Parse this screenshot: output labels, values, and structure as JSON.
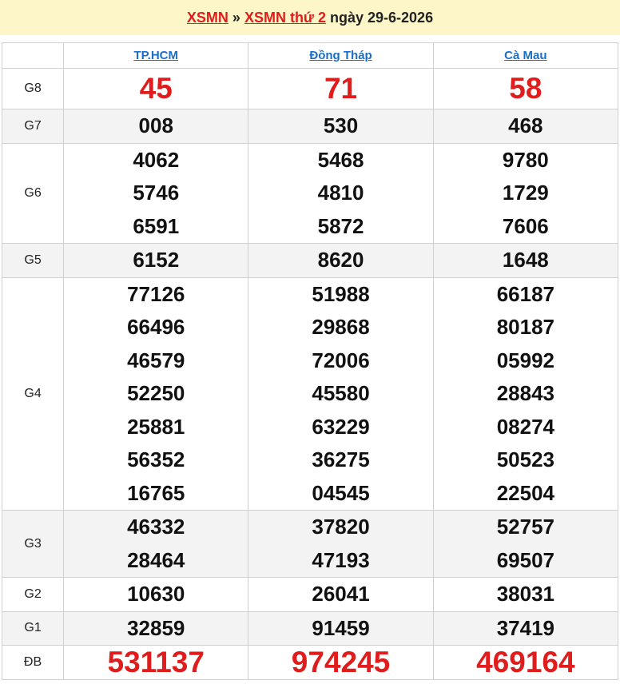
{
  "header": {
    "link1": "XSMN",
    "sep": "»",
    "link2": "XSMN thứ 2",
    "date_text": "ngày 29-6-2026"
  },
  "provinces": [
    "TP.HCM",
    "Đồng Tháp",
    "Cà Mau"
  ],
  "prizes": [
    {
      "label": "G8",
      "results": [
        [
          "45"
        ],
        [
          "71"
        ],
        [
          "58"
        ]
      ]
    },
    {
      "label": "G7",
      "results": [
        [
          "008"
        ],
        [
          "530"
        ],
        [
          "468"
        ]
      ]
    },
    {
      "label": "G6",
      "results": [
        [
          "4062",
          "5746",
          "6591"
        ],
        [
          "5468",
          "4810",
          "5872"
        ],
        [
          "9780",
          "1729",
          "7606"
        ]
      ]
    },
    {
      "label": "G5",
      "results": [
        [
          "6152"
        ],
        [
          "8620"
        ],
        [
          "1648"
        ]
      ]
    },
    {
      "label": "G4",
      "results": [
        [
          "77126",
          "66496",
          "46579",
          "52250",
          "25881",
          "56352",
          "16765"
        ],
        [
          "51988",
          "29868",
          "72006",
          "45580",
          "63229",
          "36275",
          "04545"
        ],
        [
          "66187",
          "80187",
          "05992",
          "28843",
          "08274",
          "50523",
          "22504"
        ]
      ]
    },
    {
      "label": "G3",
      "results": [
        [
          "46332",
          "28464"
        ],
        [
          "37820",
          "47193"
        ],
        [
          "52757",
          "69507"
        ]
      ]
    },
    {
      "label": "G2",
      "results": [
        [
          "10630"
        ],
        [
          "26041"
        ],
        [
          "38031"
        ]
      ]
    },
    {
      "label": "G1",
      "results": [
        [
          "32859"
        ],
        [
          "91459"
        ],
        [
          "37419"
        ]
      ]
    },
    {
      "label": "ĐB",
      "results": [
        [
          "531137"
        ],
        [
          "974245"
        ],
        [
          "469164"
        ]
      ]
    }
  ],
  "colors": {
    "accent_red": "#e01c1c",
    "link_blue": "#1a6ec8",
    "header_bg": "#fdf6c8"
  }
}
